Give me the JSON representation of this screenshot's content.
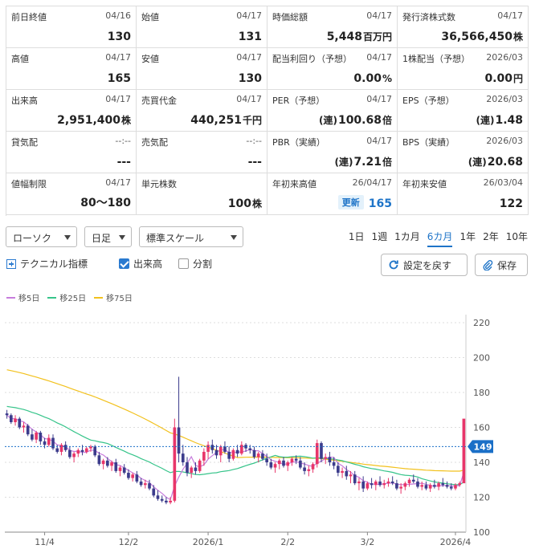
{
  "colors": {
    "up": "#e8366a",
    "down": "#3c3c8c",
    "ma5": "#c77cdc",
    "ma25": "#36c48a",
    "ma75": "#f2c11d",
    "accent": "#1e74c8",
    "current": "#1a6fc7"
  },
  "stats": [
    {
      "label": "前日終値",
      "date": "04/16",
      "value": "130",
      "unit": ""
    },
    {
      "label": "始値",
      "date": "04/17",
      "value": "131",
      "unit": ""
    },
    {
      "label": "時価総額",
      "date": "04/17",
      "value": "5,448",
      "unit": "百万円"
    },
    {
      "label": "発行済株式数",
      "date": "04/17",
      "value": "36,566,450",
      "unit": "株"
    },
    {
      "label": "高値",
      "date": "04/17",
      "value": "165",
      "unit": ""
    },
    {
      "label": "安値",
      "date": "04/17",
      "value": "130",
      "unit": ""
    },
    {
      "label": "配当利回り（予想）",
      "date": "04/17",
      "value": "0.00",
      "unit": "%"
    },
    {
      "label": "1株配当（予想）",
      "date": "2026/03",
      "value": "0.00",
      "unit": "円"
    },
    {
      "label": "出来高",
      "date": "04/17",
      "value": "2,951,400",
      "unit": "株"
    },
    {
      "label": "売買代金",
      "date": "04/17",
      "value": "440,251",
      "unit": "千円"
    },
    {
      "label": "PER（予想）",
      "date": "04/17",
      "prefix": "(連)",
      "value": "100.68",
      "unit": "倍"
    },
    {
      "label": "EPS（予想）",
      "date": "2026/03",
      "prefix": "(連)",
      "value": "1.48",
      "unit": ""
    },
    {
      "label": "貸気配",
      "date": "--:--",
      "value": "---",
      "unit": ""
    },
    {
      "label": "売気配",
      "date": "--:--",
      "value": "---",
      "unit": ""
    },
    {
      "label": "PBR（実績）",
      "date": "04/17",
      "prefix": "(連)",
      "value": "7.21",
      "unit": "倍"
    },
    {
      "label": "BPS（実績）",
      "date": "2026/03",
      "prefix": "(連)",
      "value": "20.68",
      "unit": ""
    },
    {
      "label": "値幅制限",
      "date": "04/17",
      "value": "80〜180",
      "unit": ""
    },
    {
      "label": "単元株数",
      "date": "",
      "value": "100",
      "unit": "株"
    },
    {
      "label": "年初来高値",
      "date": "26/04/17",
      "badge": "更新",
      "value": "165",
      "unit": ""
    },
    {
      "label": "年初来安値",
      "date": "26/03/04",
      "value": "122",
      "unit": ""
    }
  ],
  "controls": {
    "chart_type": "ローソク",
    "interval": "日足",
    "scale": "標準スケール",
    "periods": [
      "1日",
      "1週",
      "1カ月",
      "6カ月",
      "1年",
      "2年",
      "10年"
    ],
    "active_period": "6カ月",
    "technical_label": "テクニカル指標",
    "volume_label": "出来高",
    "split_label": "分割",
    "reset_label": "設定を戻す",
    "save_label": "保存"
  },
  "chart_data": {
    "type": "candlestick",
    "legend": [
      {
        "name": "移5日",
        "color": "#c77cdc"
      },
      {
        "name": "移25日",
        "color": "#36c48a"
      },
      {
        "name": "移75日",
        "color": "#f2c11d"
      }
    ],
    "ylim": [
      100,
      220
    ],
    "yticks": [
      "100",
      "120",
      "140",
      "160",
      "180",
      "200",
      "220"
    ],
    "xticks": [
      "11/4",
      "12/2",
      "2026/1",
      "2/2",
      "3/2",
      "2026/4"
    ],
    "xtick_index": [
      9,
      29,
      48,
      67,
      86,
      107
    ],
    "current_price": "149",
    "reference_line": 149,
    "ohlc": [
      [
        168,
        170,
        165,
        167
      ],
      [
        167,
        168,
        162,
        163
      ],
      [
        163,
        167,
        161,
        165
      ],
      [
        165,
        166,
        159,
        160
      ],
      [
        160,
        163,
        157,
        161
      ],
      [
        161,
        162,
        155,
        156
      ],
      [
        156,
        159,
        152,
        153
      ],
      [
        153,
        158,
        151,
        157
      ],
      [
        157,
        158,
        150,
        152
      ],
      [
        152,
        154,
        148,
        150
      ],
      [
        150,
        156,
        149,
        154
      ],
      [
        154,
        156,
        147,
        148
      ],
      [
        148,
        150,
        145,
        146
      ],
      [
        146,
        151,
        144,
        150
      ],
      [
        150,
        152,
        146,
        147
      ],
      [
        147,
        149,
        142,
        143
      ],
      [
        143,
        146,
        140,
        145
      ],
      [
        145,
        148,
        143,
        147
      ],
      [
        147,
        150,
        144,
        146
      ],
      [
        146,
        149,
        145,
        148
      ],
      [
        148,
        150,
        146,
        149
      ],
      [
        149,
        150,
        143,
        144
      ],
      [
        144,
        146,
        138,
        139
      ],
      [
        139,
        142,
        136,
        141
      ],
      [
        141,
        143,
        137,
        138
      ],
      [
        138,
        141,
        135,
        140
      ],
      [
        140,
        142,
        134,
        135
      ],
      [
        135,
        138,
        132,
        137
      ],
      [
        137,
        139,
        133,
        134
      ],
      [
        134,
        136,
        130,
        131
      ],
      [
        131,
        134,
        129,
        133
      ],
      [
        133,
        135,
        128,
        129
      ],
      [
        129,
        131,
        126,
        127
      ],
      [
        127,
        130,
        125,
        128
      ],
      [
        128,
        130,
        124,
        125
      ],
      [
        125,
        127,
        120,
        121
      ],
      [
        121,
        124,
        118,
        119
      ],
      [
        119,
        121,
        117,
        118
      ],
      [
        118,
        120,
        116,
        117
      ],
      [
        117,
        120,
        116,
        118
      ],
      [
        118,
        165,
        117,
        160
      ],
      [
        160,
        189,
        140,
        145
      ],
      [
        145,
        150,
        138,
        140
      ],
      [
        140,
        143,
        132,
        134
      ],
      [
        134,
        138,
        131,
        137
      ],
      [
        137,
        140,
        133,
        135
      ],
      [
        135,
        142,
        134,
        141
      ],
      [
        141,
        148,
        138,
        146
      ],
      [
        146,
        152,
        142,
        150
      ],
      [
        150,
        153,
        145,
        147
      ],
      [
        147,
        150,
        142,
        144
      ],
      [
        144,
        150,
        140,
        149
      ],
      [
        149,
        152,
        145,
        146
      ],
      [
        146,
        149,
        140,
        142
      ],
      [
        142,
        148,
        141,
        147
      ],
      [
        147,
        150,
        143,
        145
      ],
      [
        145,
        152,
        144,
        150
      ],
      [
        150,
        151,
        146,
        148
      ],
      [
        148,
        150,
        145,
        147
      ],
      [
        147,
        149,
        142,
        143
      ],
      [
        143,
        146,
        140,
        145
      ],
      [
        145,
        147,
        141,
        142
      ],
      [
        142,
        145,
        138,
        140
      ],
      [
        140,
        142,
        136,
        137
      ],
      [
        137,
        140,
        134,
        139
      ],
      [
        139,
        142,
        136,
        141
      ],
      [
        141,
        143,
        137,
        138
      ],
      [
        138,
        141,
        135,
        140
      ],
      [
        140,
        143,
        138,
        142
      ],
      [
        142,
        144,
        139,
        141
      ],
      [
        141,
        143,
        136,
        137
      ],
      [
        137,
        140,
        133,
        135
      ],
      [
        135,
        138,
        132,
        136
      ],
      [
        136,
        140,
        134,
        139
      ],
      [
        139,
        153,
        137,
        151
      ],
      [
        151,
        152,
        140,
        142
      ],
      [
        142,
        145,
        139,
        143
      ],
      [
        143,
        146,
        138,
        140
      ],
      [
        140,
        143,
        136,
        138
      ],
      [
        138,
        140,
        132,
        134
      ],
      [
        134,
        137,
        131,
        135
      ],
      [
        135,
        138,
        130,
        132
      ],
      [
        132,
        135,
        128,
        133
      ],
      [
        133,
        135,
        127,
        128
      ],
      [
        128,
        131,
        124,
        129
      ],
      [
        129,
        132,
        123,
        125
      ],
      [
        125,
        129,
        124,
        128
      ],
      [
        128,
        131,
        125,
        127
      ],
      [
        127,
        130,
        124,
        129
      ],
      [
        129,
        132,
        126,
        127
      ],
      [
        127,
        130,
        125,
        128
      ],
      [
        128,
        131,
        126,
        129
      ],
      [
        129,
        132,
        127,
        128
      ],
      [
        128,
        130,
        124,
        125
      ],
      [
        125,
        128,
        122,
        126
      ],
      [
        126,
        129,
        124,
        128
      ],
      [
        128,
        131,
        126,
        130
      ],
      [
        130,
        133,
        128,
        129
      ],
      [
        129,
        131,
        125,
        126
      ],
      [
        126,
        129,
        124,
        127
      ],
      [
        127,
        129,
        124,
        125
      ],
      [
        125,
        128,
        123,
        127
      ],
      [
        127,
        130,
        125,
        126
      ],
      [
        126,
        129,
        124,
        128
      ],
      [
        128,
        131,
        126,
        127
      ],
      [
        127,
        129,
        125,
        126
      ],
      [
        126,
        128,
        124,
        125
      ],
      [
        125,
        128,
        124,
        127
      ],
      [
        127,
        129,
        126,
        128
      ],
      [
        128,
        131,
        130,
        165
      ]
    ]
  }
}
